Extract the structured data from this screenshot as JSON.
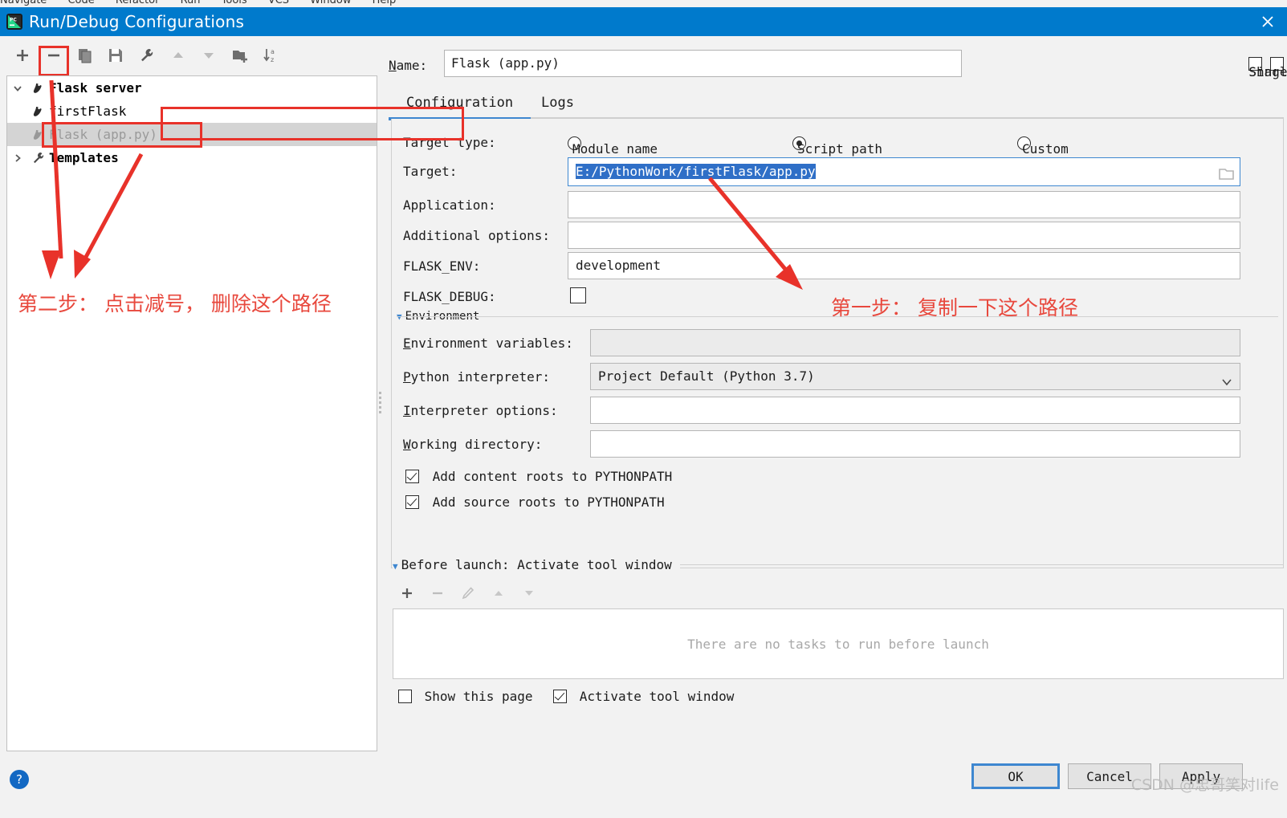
{
  "menubar": {
    "items": [
      "Navigate",
      "Code",
      "Refactor",
      "Run",
      "Tools",
      "VCS",
      "Window",
      "Help"
    ]
  },
  "window": {
    "title": "Run/Debug Configurations",
    "app_icon": "pycharm-icon",
    "close_icon": "close-icon"
  },
  "toolbar": {
    "add": "+",
    "remove": "−",
    "copy": "copy-icon",
    "save": "save-icon",
    "edit_templates": "wrench-icon",
    "move_up": "arrow-up-icon",
    "move_down": "arrow-down-icon",
    "new_folder": "new-folder-icon",
    "sort": "sort-alpha-icon"
  },
  "tree": {
    "nodes": [
      {
        "label": "Flask server",
        "icon": "flask-icon",
        "expanded": true,
        "bold": true,
        "indent": 0,
        "selected": false,
        "dim": false
      },
      {
        "label": "firstFlask",
        "icon": "flask-icon",
        "bold": false,
        "indent": 1,
        "selected": false,
        "dim": false
      },
      {
        "label": "Flask (app.py)",
        "icon": "flask-icon",
        "bold": false,
        "indent": 1,
        "selected": true,
        "dim": true
      },
      {
        "label": "Templates",
        "icon": "wrench-icon",
        "expanded": false,
        "bold": true,
        "indent": 0,
        "selected": false,
        "dim": false
      }
    ]
  },
  "form": {
    "name_label": "Name:",
    "name_value": "Flask (app.py)",
    "share_label": "Share",
    "share_checked": false,
    "single_instance_label": "Single instance only",
    "single_instance_checked": false,
    "tabs": [
      {
        "label": "Configuration",
        "active": true
      },
      {
        "label": "Logs",
        "active": false
      }
    ],
    "target_type_label": "Target type:",
    "target_type_options": [
      {
        "label": "Module name",
        "selected": false
      },
      {
        "label": "Script path",
        "selected": true
      },
      {
        "label": "Custom",
        "selected": false
      }
    ],
    "target_label": "Target:",
    "target_value": "E:/PythonWork/firstFlask/app.py",
    "application_label": "Application:",
    "application_value": "",
    "additional_options_label": "Additional options:",
    "additional_options_value": "",
    "flask_env_label": "FLASK_ENV:",
    "flask_env_value": "development",
    "flask_debug_label": "FLASK_DEBUG:",
    "flask_debug_checked": false,
    "environment_group_label": "Environment",
    "environment_variables_label": "Environment variables:",
    "environment_variables_value": "",
    "python_interpreter_label": "Python interpreter:",
    "python_interpreter_value": "Project Default (Python 3.7)",
    "interpreter_options_label": "Interpreter options:",
    "interpreter_options_value": "",
    "working_directory_label": "Working directory:",
    "working_directory_value": "",
    "add_content_roots_label": "Add content roots to PYTHONPATH",
    "add_content_roots_checked": true,
    "add_source_roots_label": "Add source roots to PYTHONPATH",
    "add_source_roots_checked": true
  },
  "before_launch": {
    "header": "Before launch: Activate tool window",
    "tools": {
      "add": "+",
      "remove": "−",
      "edit": "pencil-icon",
      "up": "arrow-up-icon",
      "down": "arrow-down-icon"
    },
    "empty_text": "There are no tasks to run before launch",
    "show_this_page_label": "Show this page",
    "show_this_page_checked": false,
    "activate_tool_window_label": "Activate tool window",
    "activate_tool_window_checked": true
  },
  "buttons": {
    "ok": "OK",
    "cancel": "Cancel",
    "apply": "Apply",
    "help": "?"
  },
  "annotations": {
    "step_two": "第二步： 点击减号， 删除这个路径",
    "step_one": "第一步： 复制一下这个路径"
  },
  "watermark": "CSDN @忠哥笑对life",
  "colors": {
    "titlebar": "#007acc",
    "accent": "#3e87d0",
    "annotation_red": "#e8483d",
    "selection_blue": "#2f6fc7"
  }
}
